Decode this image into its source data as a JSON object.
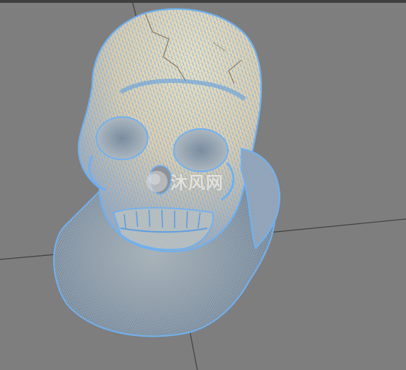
{
  "viewport": {
    "background_color": "#7e7e7e",
    "grid_line_color": "#404040",
    "wireframe_color": "#6fb0f0",
    "shading_light": "#f6ddb0",
    "shading_shadow": "#7c8088"
  },
  "model": {
    "icon": "skull-wireframe-icon",
    "display_mode": "wireframe-shaded"
  },
  "watermark": {
    "text": "沐风网",
    "logo_icon": "mufeng-logo-icon"
  }
}
